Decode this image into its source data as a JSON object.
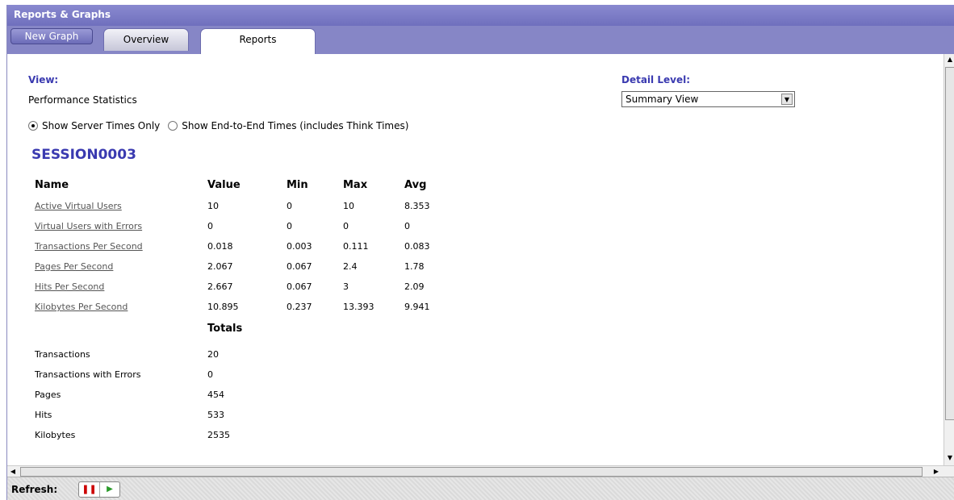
{
  "window": {
    "title": "Reports & Graphs"
  },
  "toolbar": {
    "new_graph_label": "New Graph"
  },
  "tabs": [
    {
      "label": "Overview",
      "active": false
    },
    {
      "label": "Reports",
      "active": true
    }
  ],
  "view": {
    "label": "View:",
    "value": "Performance Statistics",
    "radio_options": [
      {
        "label": "Show Server Times Only",
        "checked": true
      },
      {
        "label": "Show End-to-End Times (includes Think Times)",
        "checked": false
      }
    ]
  },
  "detail_level": {
    "label": "Detail Level:",
    "selected": "Summary View"
  },
  "session": {
    "name": "SESSION0003"
  },
  "stats_table": {
    "headers": [
      "Name",
      "Value",
      "Min",
      "Max",
      "Avg"
    ],
    "rows": [
      {
        "name": "Active Virtual Users",
        "value": "10",
        "min": "0",
        "max": "10",
        "avg": "8.353"
      },
      {
        "name": "Virtual Users with Errors",
        "value": "0",
        "min": "0",
        "max": "0",
        "avg": "0"
      },
      {
        "name": "Transactions Per Second",
        "value": "0.018",
        "min": "0.003",
        "max": "0.111",
        "avg": "0.083"
      },
      {
        "name": "Pages Per Second",
        "value": "2.067",
        "min": "0.067",
        "max": "2.4",
        "avg": "1.78"
      },
      {
        "name": "Hits Per Second",
        "value": "2.667",
        "min": "0.067",
        "max": "3",
        "avg": "2.09"
      },
      {
        "name": "Kilobytes Per Second",
        "value": "10.895",
        "min": "0.237",
        "max": "13.393",
        "avg": "9.941"
      }
    ]
  },
  "totals": {
    "header": "Totals",
    "rows": [
      {
        "name": "Transactions",
        "value": "20"
      },
      {
        "name": "Transactions with Errors",
        "value": "0"
      },
      {
        "name": "Pages",
        "value": "454"
      },
      {
        "name": "Hits",
        "value": "533"
      },
      {
        "name": "Kilobytes",
        "value": "2535"
      }
    ]
  },
  "refresh": {
    "label": "Refresh:",
    "pause_icon": "pause-icon",
    "play_icon": "play-icon"
  },
  "icons": {
    "scroll_up": "triangle-up-icon",
    "scroll_down": "triangle-down-icon",
    "scroll_left": "triangle-left-icon",
    "scroll_right": "triangle-right-icon",
    "select_arrow": "chevron-down-icon"
  },
  "colors": {
    "title_bar": "#7a7ac6",
    "tab_bar": "#8686c6",
    "accent_text": "#3a3ab0",
    "pause_red": "#cc0000",
    "play_green": "#2a9a2a"
  }
}
